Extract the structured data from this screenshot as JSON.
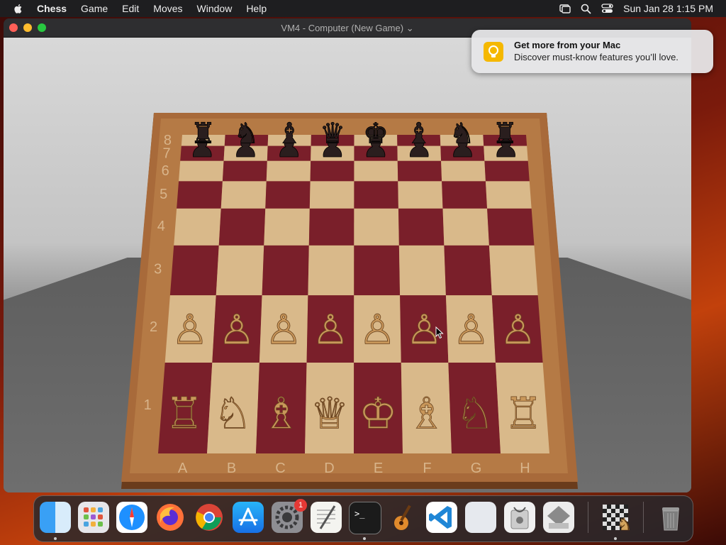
{
  "menubar": {
    "app": "Chess",
    "items": [
      "Game",
      "Edit",
      "Moves",
      "Window",
      "Help"
    ],
    "clock": "Sun Jan 28  1:15 PM"
  },
  "window": {
    "title": "VM4 - Computer   (New Game)"
  },
  "notification": {
    "title": "Get more from your Mac",
    "body": "Discover must-know features you’ll love."
  },
  "board": {
    "ranks": [
      "8",
      "7",
      "6",
      "5",
      "4",
      "3",
      "2",
      "1"
    ],
    "files": [
      "A",
      "B",
      "C",
      "D",
      "E",
      "F",
      "G",
      "H"
    ],
    "colors": {
      "light": "#d9b98a",
      "dark": "#7a1f2a",
      "frame": "#a86a3a",
      "white_piece": "#c9975a",
      "black_piece": "#2a1e1e"
    },
    "pieces": {
      "8": [
        "♜",
        "♞",
        "♝",
        "♛",
        "♚",
        "♝",
        "♞",
        "♜"
      ],
      "7": [
        "♟",
        "♟",
        "♟",
        "♟",
        "♟",
        "♟",
        "♟",
        "♟"
      ],
      "2": [
        "♙",
        "♙",
        "♙",
        "♙",
        "♙",
        "♙",
        "♙",
        "♙"
      ],
      "1": [
        "♖",
        "♘",
        "♗",
        "♕",
        "♔",
        "♗",
        "♘",
        "♖"
      ]
    }
  },
  "dock": {
    "apps": [
      "Finder",
      "Launchpad",
      "Safari",
      "Firefox",
      "Chrome",
      "App Store",
      "System Settings",
      "TextEdit",
      "Terminal",
      "GarageBand",
      "Visual Studio Code",
      "Preview",
      "Disk Utility",
      "Boot Camp Assistant",
      "Chess",
      "Trash"
    ],
    "badge": "1"
  }
}
